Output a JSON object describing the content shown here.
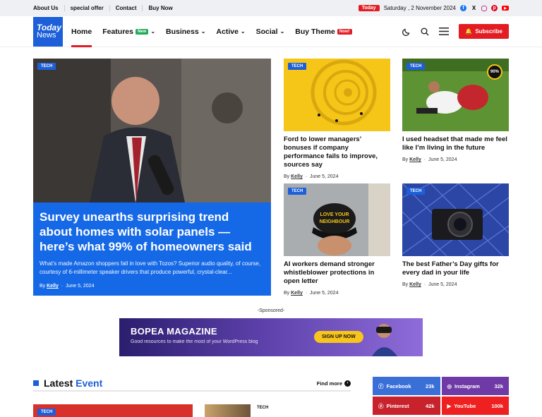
{
  "topbar": {
    "links": [
      "About Us",
      "special offer",
      "Contact",
      "Buy Now"
    ],
    "today_label": "Today",
    "date": "Saturday , 2 November 2024",
    "social_icons": [
      "facebook-icon",
      "x-icon",
      "instagram-icon",
      "pinterest-icon",
      "youtube-icon"
    ]
  },
  "logo": {
    "line1": "Today",
    "line2": "News"
  },
  "nav": {
    "home": "Home",
    "features": "Features",
    "features_badge": "New",
    "business": "Business",
    "active": "Active",
    "social": "Social",
    "buy_theme": "Buy Theme",
    "buy_theme_badge": "Now!"
  },
  "header": {
    "subscribe_label": "Subscribe"
  },
  "hero": {
    "tag": "TECH",
    "title": "Survey unearths surprising trend about homes with solar panels — here’s what 99% of homeowners said",
    "excerpt": "What’s made Amazon shoppers fall in love with Tozos? Superior audio quality, of course, courtesy of 6-millimeter speaker drivers that produce powerful, crystal-clear...",
    "by": "By",
    "author": "Kelly",
    "date": "June 5, 2024"
  },
  "cards": [
    {
      "tag": "TECH",
      "title": "Ford to lower managers’ bonuses if company performance fails to improve, sources say",
      "by": "By",
      "author": "Kelly",
      "date": "June 5, 2024"
    },
    {
      "tag": "TECH",
      "title": "I used headset that made me feel like I’m living in the future",
      "by": "By",
      "author": "Kelly",
      "date": "June 5, 2024",
      "score": "90%"
    },
    {
      "tag": "TECH",
      "title": "AI workers demand stronger whistleblower protections in open letter",
      "by": "By",
      "author": "Kelly",
      "date": "June 5, 2024",
      "cap_text1": "LOVE YOUR",
      "cap_text2": "NEIGHBOUR"
    },
    {
      "tag": "TECH",
      "title": "The best Father’s Day gifts for every dad in your life",
      "by": "By",
      "author": "Kelly",
      "date": "June 5, 2024"
    }
  ],
  "sponsored": "-Sponsored-",
  "banner": {
    "title": "BOPEA MAGAZINE",
    "subtitle": "Good resources to make the most of your WordPress blog",
    "button": "SIGN UP NOW"
  },
  "latest": {
    "title_part1": "Latest",
    "title_part2": "Event",
    "find_more": "Find more"
  },
  "socials": [
    {
      "name": "Facebook",
      "count": "23k",
      "color": "#3b6fd8",
      "icon": "facebook-icon"
    },
    {
      "name": "Instagram",
      "count": "32k",
      "color": "#6f3aa6",
      "icon": "instagram-icon"
    },
    {
      "name": "Pinterest",
      "count": "42k",
      "color": "#c8232c",
      "icon": "pinterest-icon"
    },
    {
      "name": "YouTube",
      "count": "100k",
      "color": "#ef2020",
      "icon": "youtube-icon"
    }
  ],
  "bottom": {
    "tag1": "TECH",
    "tag2": "TECH"
  },
  "colors": {
    "accent": "#1c5fd9",
    "red": "#e31b23",
    "hero_blue": "#1669e6"
  }
}
